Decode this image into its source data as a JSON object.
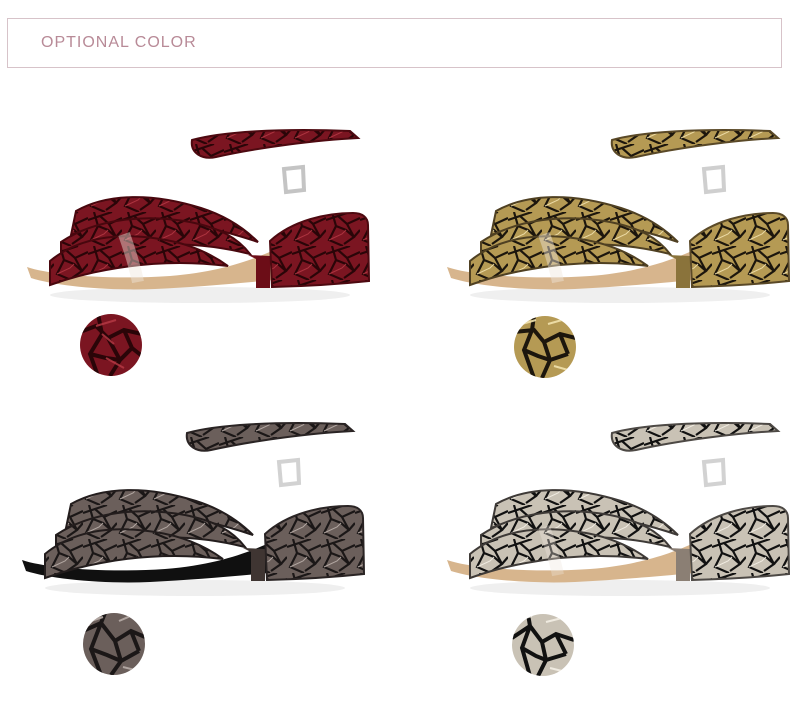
{
  "header": {
    "title": "OPTIONAL COLOR"
  },
  "variants": [
    {
      "color_icon": "wine-red-cracked-swatch-icon",
      "base": "#7b1521",
      "pattern": "#2a0508",
      "highlight": "#b93b46"
    },
    {
      "color_icon": "gold-cracked-swatch-icon",
      "base": "#b59a54",
      "pattern": "#1c160d",
      "highlight": "#f1e2ad"
    },
    {
      "color_icon": "gunmetal-cracked-swatch-icon",
      "base": "#6b5f5b",
      "pattern": "#1b1717",
      "highlight": "#b9aea9"
    },
    {
      "color_icon": "silver-black-cracked-swatch-icon",
      "base": "#c9c2b5",
      "pattern": "#111111",
      "highlight": "#f4f0e6"
    }
  ]
}
